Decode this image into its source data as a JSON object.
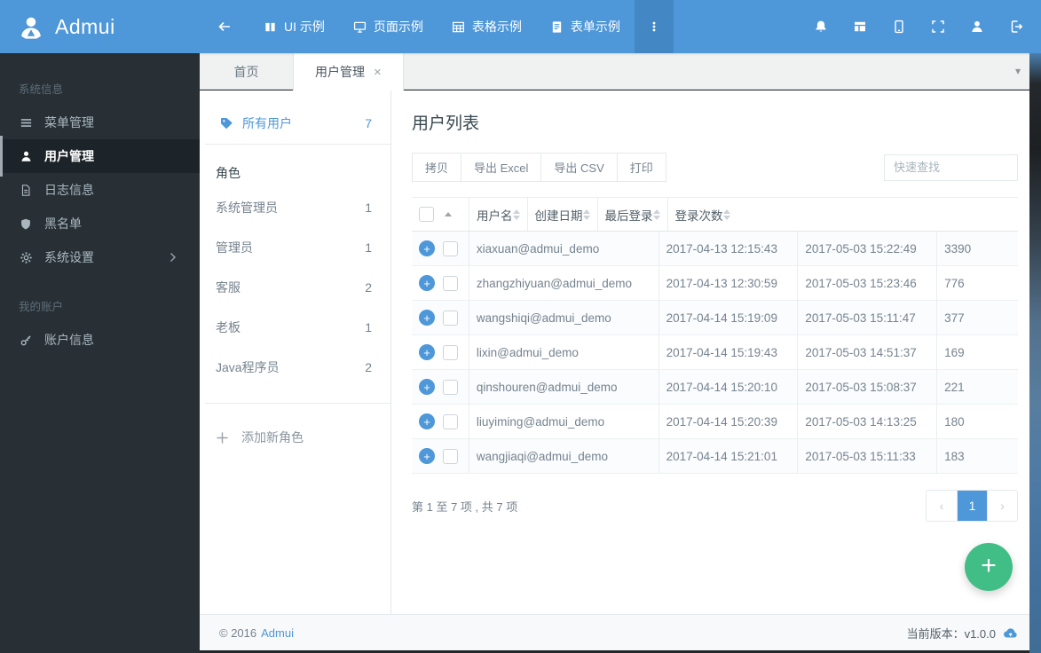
{
  "navbar": {
    "brand": "Admui",
    "menu": [
      {
        "label": "UI 示例"
      },
      {
        "label": "页面示例"
      },
      {
        "label": "表格示例"
      },
      {
        "label": "表单示例"
      }
    ]
  },
  "sidebar": {
    "sections": [
      {
        "label": "系统信息",
        "items": [
          {
            "label": "菜单管理"
          },
          {
            "label": "用户管理"
          },
          {
            "label": "日志信息"
          },
          {
            "label": "黑名单"
          },
          {
            "label": "系统设置"
          }
        ]
      },
      {
        "label": "我的账户",
        "items": [
          {
            "label": "账户信息"
          }
        ]
      }
    ]
  },
  "tabbar": {
    "tabs": [
      {
        "label": "首页"
      },
      {
        "label": "用户管理",
        "close_glyph": "×"
      }
    ],
    "caret_glyph": "▾"
  },
  "users_panel": {
    "all_users_label": "所有用户",
    "all_users_count": "7",
    "roles_header": "角色",
    "roles": [
      {
        "name": "系统管理员",
        "count": "1"
      },
      {
        "name": "管理员",
        "count": "1"
      },
      {
        "name": "客服",
        "count": "2"
      },
      {
        "name": "老板",
        "count": "1"
      },
      {
        "name": "Java程序员",
        "count": "2"
      }
    ],
    "add_role_label": "添加新角色"
  },
  "main": {
    "title": "用户列表",
    "toolbar": {
      "buttons": [
        "拷贝",
        "导出 Excel",
        "导出 CSV",
        "打印"
      ],
      "search_placeholder": "快速查找",
      "search_value": ""
    },
    "table": {
      "columns": [
        "用户名",
        "创建日期",
        "最后登录",
        "登录次数"
      ],
      "rows": [
        {
          "username": "xiaxuan@admui_demo",
          "created": "2017-04-13 12:15:43",
          "last_login": "2017-05-03 15:22:49",
          "logins": "3390"
        },
        {
          "username": "zhangzhiyuan@admui_demo",
          "created": "2017-04-13 12:30:59",
          "last_login": "2017-05-03 15:23:46",
          "logins": "776"
        },
        {
          "username": "wangshiqi@admui_demo",
          "created": "2017-04-14 15:19:09",
          "last_login": "2017-05-03 15:11:47",
          "logins": "377"
        },
        {
          "username": "lixin@admui_demo",
          "created": "2017-04-14 15:19:43",
          "last_login": "2017-05-03 14:51:37",
          "logins": "169"
        },
        {
          "username": "qinshouren@admui_demo",
          "created": "2017-04-14 15:20:10",
          "last_login": "2017-05-03 15:08:37",
          "logins": "221"
        },
        {
          "username": "liuyiming@admui_demo",
          "created": "2017-04-14 15:20:39",
          "last_login": "2017-05-03 14:13:25",
          "logins": "180"
        },
        {
          "username": "wangjiaqi@admui_demo",
          "created": "2017-04-14 15:21:01",
          "last_login": "2017-05-03 15:11:33",
          "logins": "183"
        }
      ]
    },
    "info": "第 1 至 7 项 , 共 7 项",
    "pagination": {
      "prev_glyph": "‹",
      "page": "1",
      "next_glyph": "›"
    }
  },
  "footer": {
    "copyright": "© 2016",
    "brand_link": "Admui",
    "version_label": "当前版本：v1.0.0"
  },
  "icons": {
    "fab_plus_glyph": "+",
    "expand_row_glyph": "+"
  },
  "colors": {
    "primary": "#4e97d8",
    "sidebar_bg": "#283036",
    "fab_green": "#41bd86"
  }
}
